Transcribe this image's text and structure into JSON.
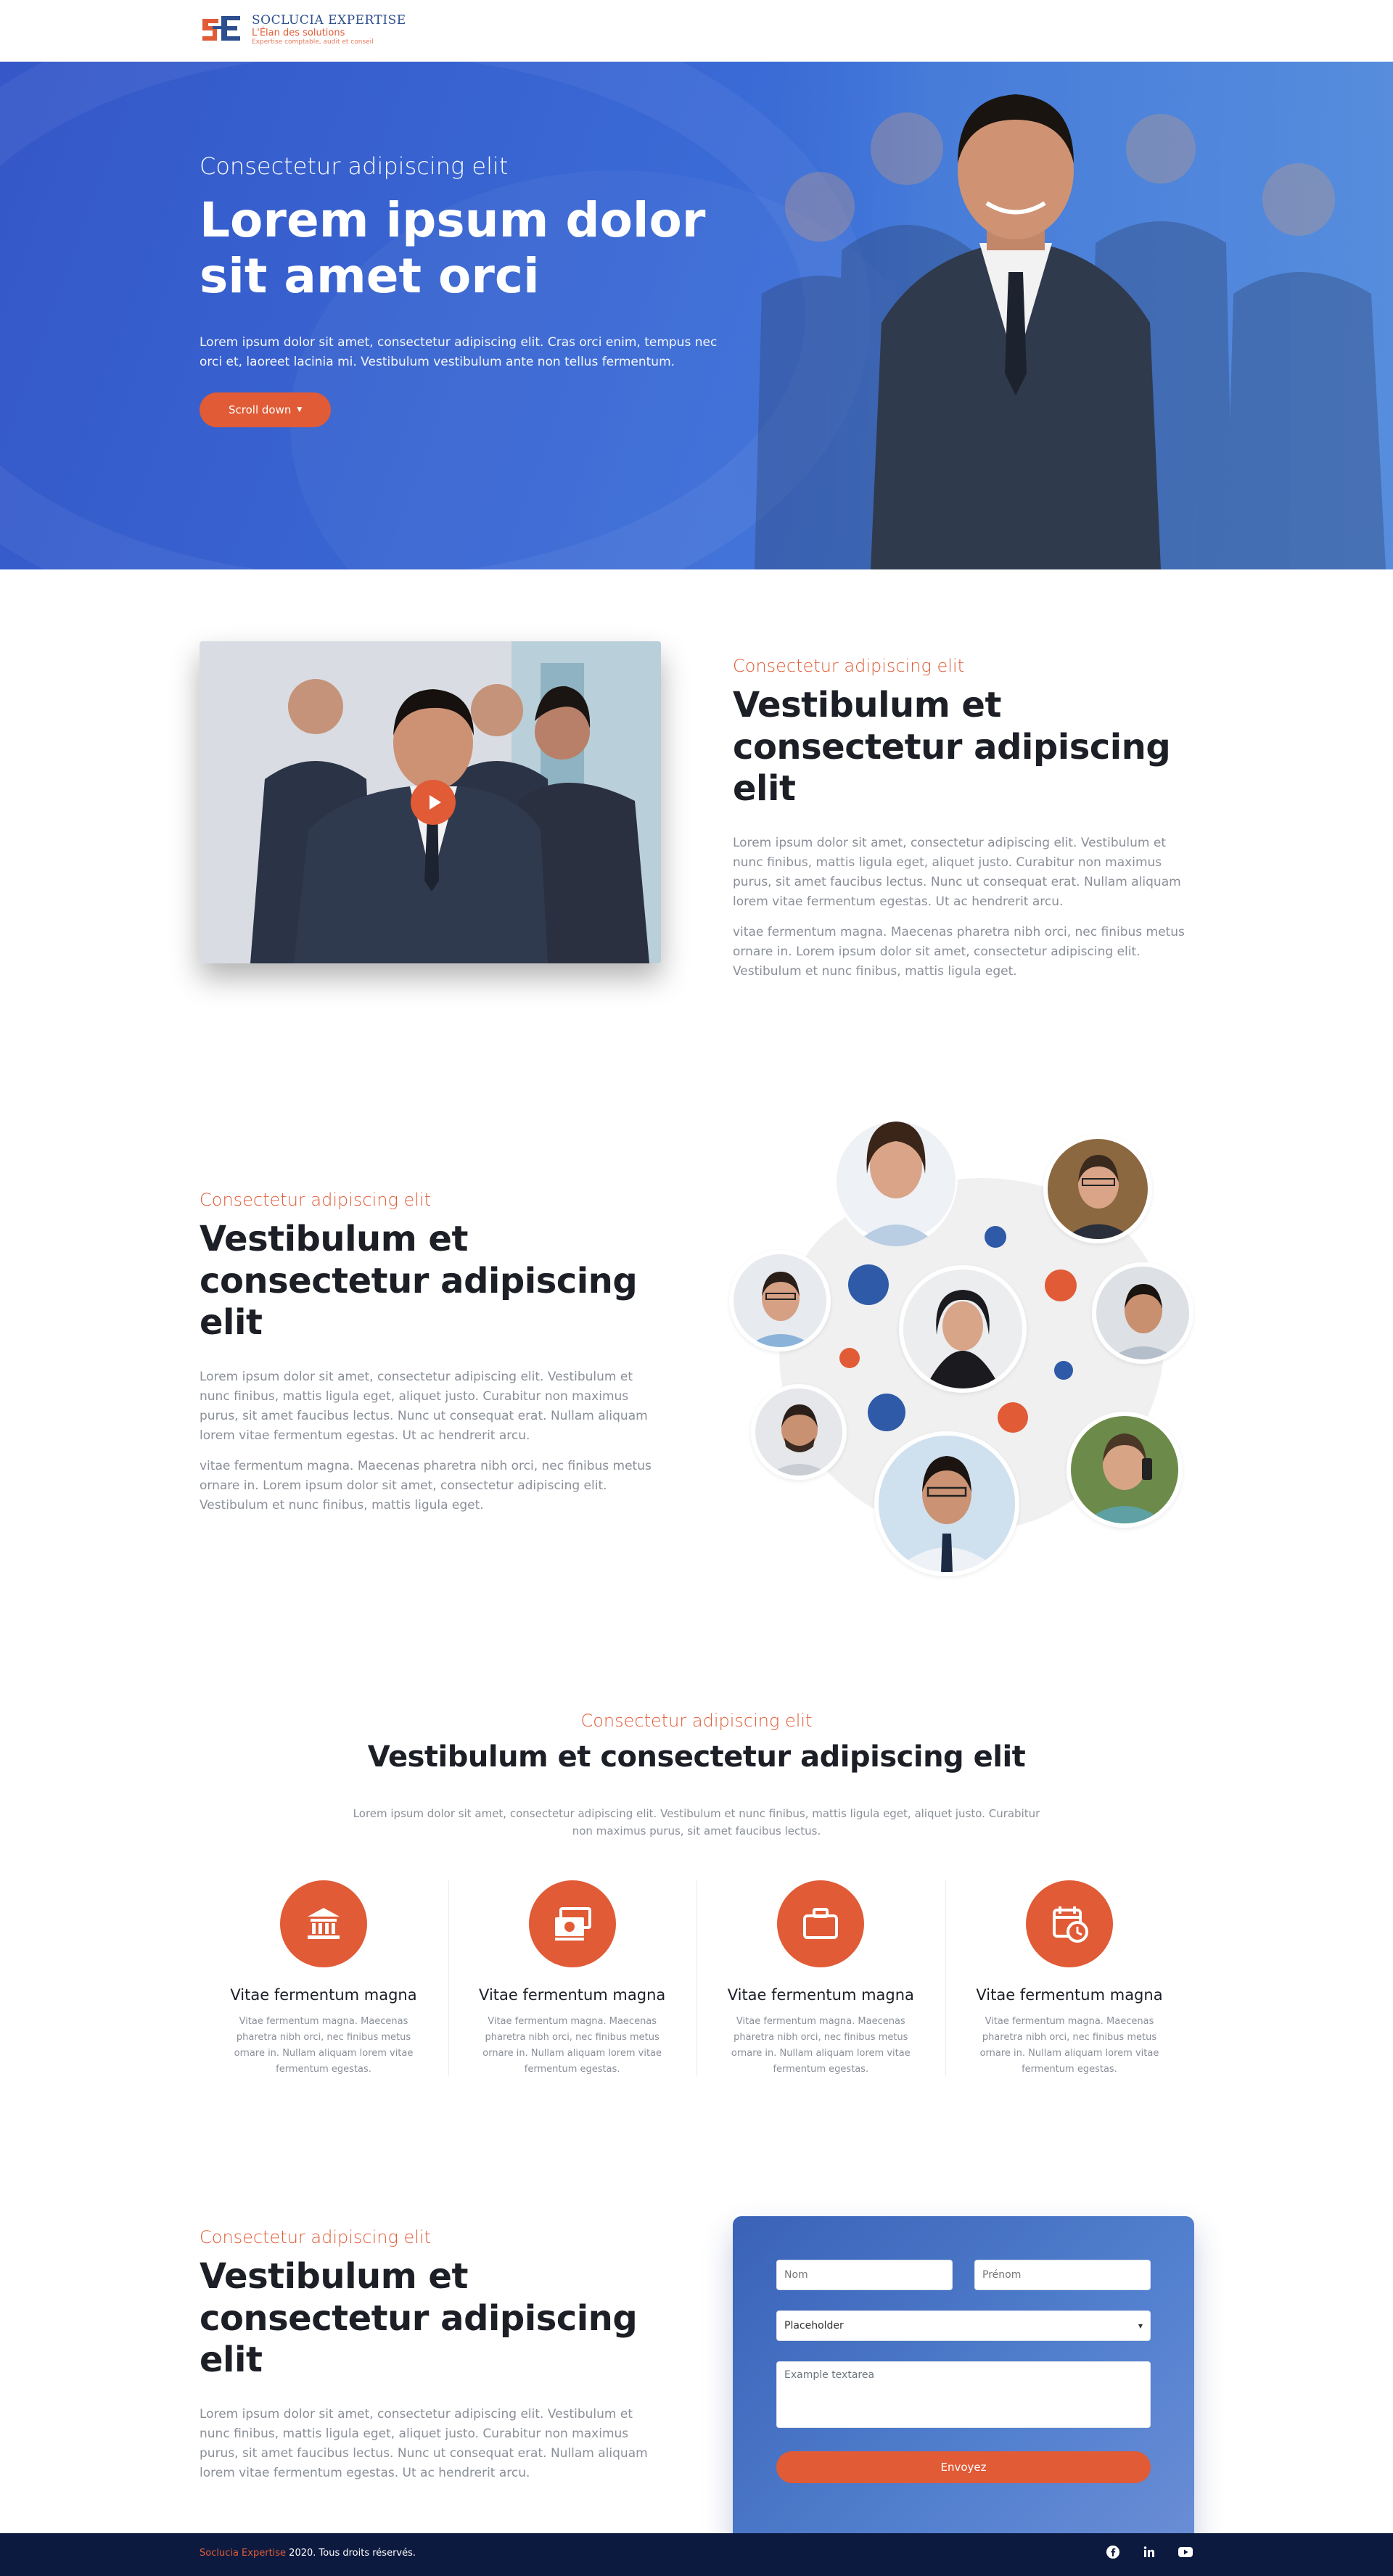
{
  "header": {
    "brand": "SOCLUCIA EXPERTISE",
    "tagline": "L'Élan des solutions",
    "subtagline": "Expertise comptable, audit et conseil"
  },
  "hero": {
    "subtitle": "Consectetur adipiscing elit",
    "title": "Lorem ipsum dolor sit amet orci",
    "text": "Lorem ipsum dolor sit amet, consectetur adipiscing elit. Cras orci enim, tempus nec orci et, laoreet lacinia mi. Vestibulum vestibulum ante non tellus fermentum.",
    "button": "Scroll down"
  },
  "about": {
    "eyebrow": "Consectetur adipiscing elit",
    "title": "Vestibulum et consectetur adipiscing elit",
    "p1": "Lorem ipsum dolor sit amet, consectetur adipiscing elit. Vestibulum et nunc finibus, mattis ligula eget, aliquet justo. Curabitur non maximus purus, sit amet faucibus lectus. Nunc ut consequat erat. Nullam aliquam lorem vitae fermentum egestas. Ut ac hendrerit arcu.",
    "p2": "vitae fermentum magna. Maecenas pharetra nibh orci, nec finibus metus ornare in. Lorem ipsum dolor sit amet, consectetur adipiscing elit. Vestibulum et nunc finibus, mattis ligula eget."
  },
  "team": {
    "eyebrow": "Consectetur adipiscing elit",
    "title": "Vestibulum et consectetur adipiscing elit",
    "p1": "Lorem ipsum dolor sit amet, consectetur adipiscing elit. Vestibulum et nunc finibus, mattis ligula eget, aliquet justo. Curabitur non maximus purus, sit amet faucibus lectus. Nunc ut consequat erat. Nullam aliquam lorem vitae fermentum egestas. Ut ac hendrerit arcu.",
    "p2": "vitae fermentum magna. Maecenas pharetra nibh orci, nec finibus metus ornare in. Lorem ipsum dolor sit amet, consectetur adipiscing elit. Vestibulum et nunc finibus, mattis ligula eget."
  },
  "services": {
    "eyebrow": "Consectetur adipiscing elit",
    "title": "Vestibulum et consectetur adipiscing elit",
    "intro": "Lorem ipsum dolor sit amet, consectetur adipiscing elit. Vestibulum et nunc finibus, mattis ligula eget, aliquet justo. Curabitur non maximus purus, sit amet faucibus lectus.",
    "items": [
      {
        "icon": "bank-icon",
        "title": "Vitae fermentum magna",
        "text": "Vitae fermentum magna. Maecenas pharetra nibh orci, nec finibus metus ornare in. Nullam aliquam lorem vitae fermentum egestas."
      },
      {
        "icon": "money-icon",
        "title": "Vitae fermentum magna",
        "text": "Vitae fermentum magna. Maecenas pharetra nibh orci, nec finibus metus ornare in. Nullam aliquam lorem vitae fermentum egestas."
      },
      {
        "icon": "briefcase-icon",
        "title": "Vitae fermentum magna",
        "text": "Vitae fermentum magna. Maecenas pharetra nibh orci, nec finibus metus ornare in. Nullam aliquam lorem vitae fermentum egestas."
      },
      {
        "icon": "calendar-clock-icon",
        "title": "Vitae fermentum magna",
        "text": "Vitae fermentum magna. Maecenas pharetra nibh orci, nec finibus metus ornare in. Nullam aliquam lorem vitae fermentum egestas."
      }
    ]
  },
  "contact": {
    "eyebrow": "Consectetur adipiscing elit",
    "title": "Vestibulum et consectetur adipiscing elit",
    "p1": "Lorem ipsum dolor sit amet, consectetur adipiscing elit. Vestibulum et nunc finibus, mattis ligula eget, aliquet justo. Curabitur non maximus purus, sit amet faucibus lectus. Nunc ut consequat erat. Nullam aliquam lorem vitae fermentum egestas. Ut ac hendrerit arcu.",
    "form": {
      "nom_placeholder": "Nom",
      "prenom_placeholder": "Prénom",
      "select_value": "Placeholder",
      "textarea_placeholder": "Example textarea",
      "submit": "Envoyez"
    }
  },
  "footer": {
    "brand": "Soclucia Expertise",
    "rights": " 2020. Tous droits réservés.",
    "social": [
      "facebook-icon",
      "linkedin-icon",
      "youtube-icon"
    ]
  },
  "colors": {
    "accent": "#e05b36",
    "primary": "#3a63c8",
    "footer": "#0d1a3f"
  }
}
